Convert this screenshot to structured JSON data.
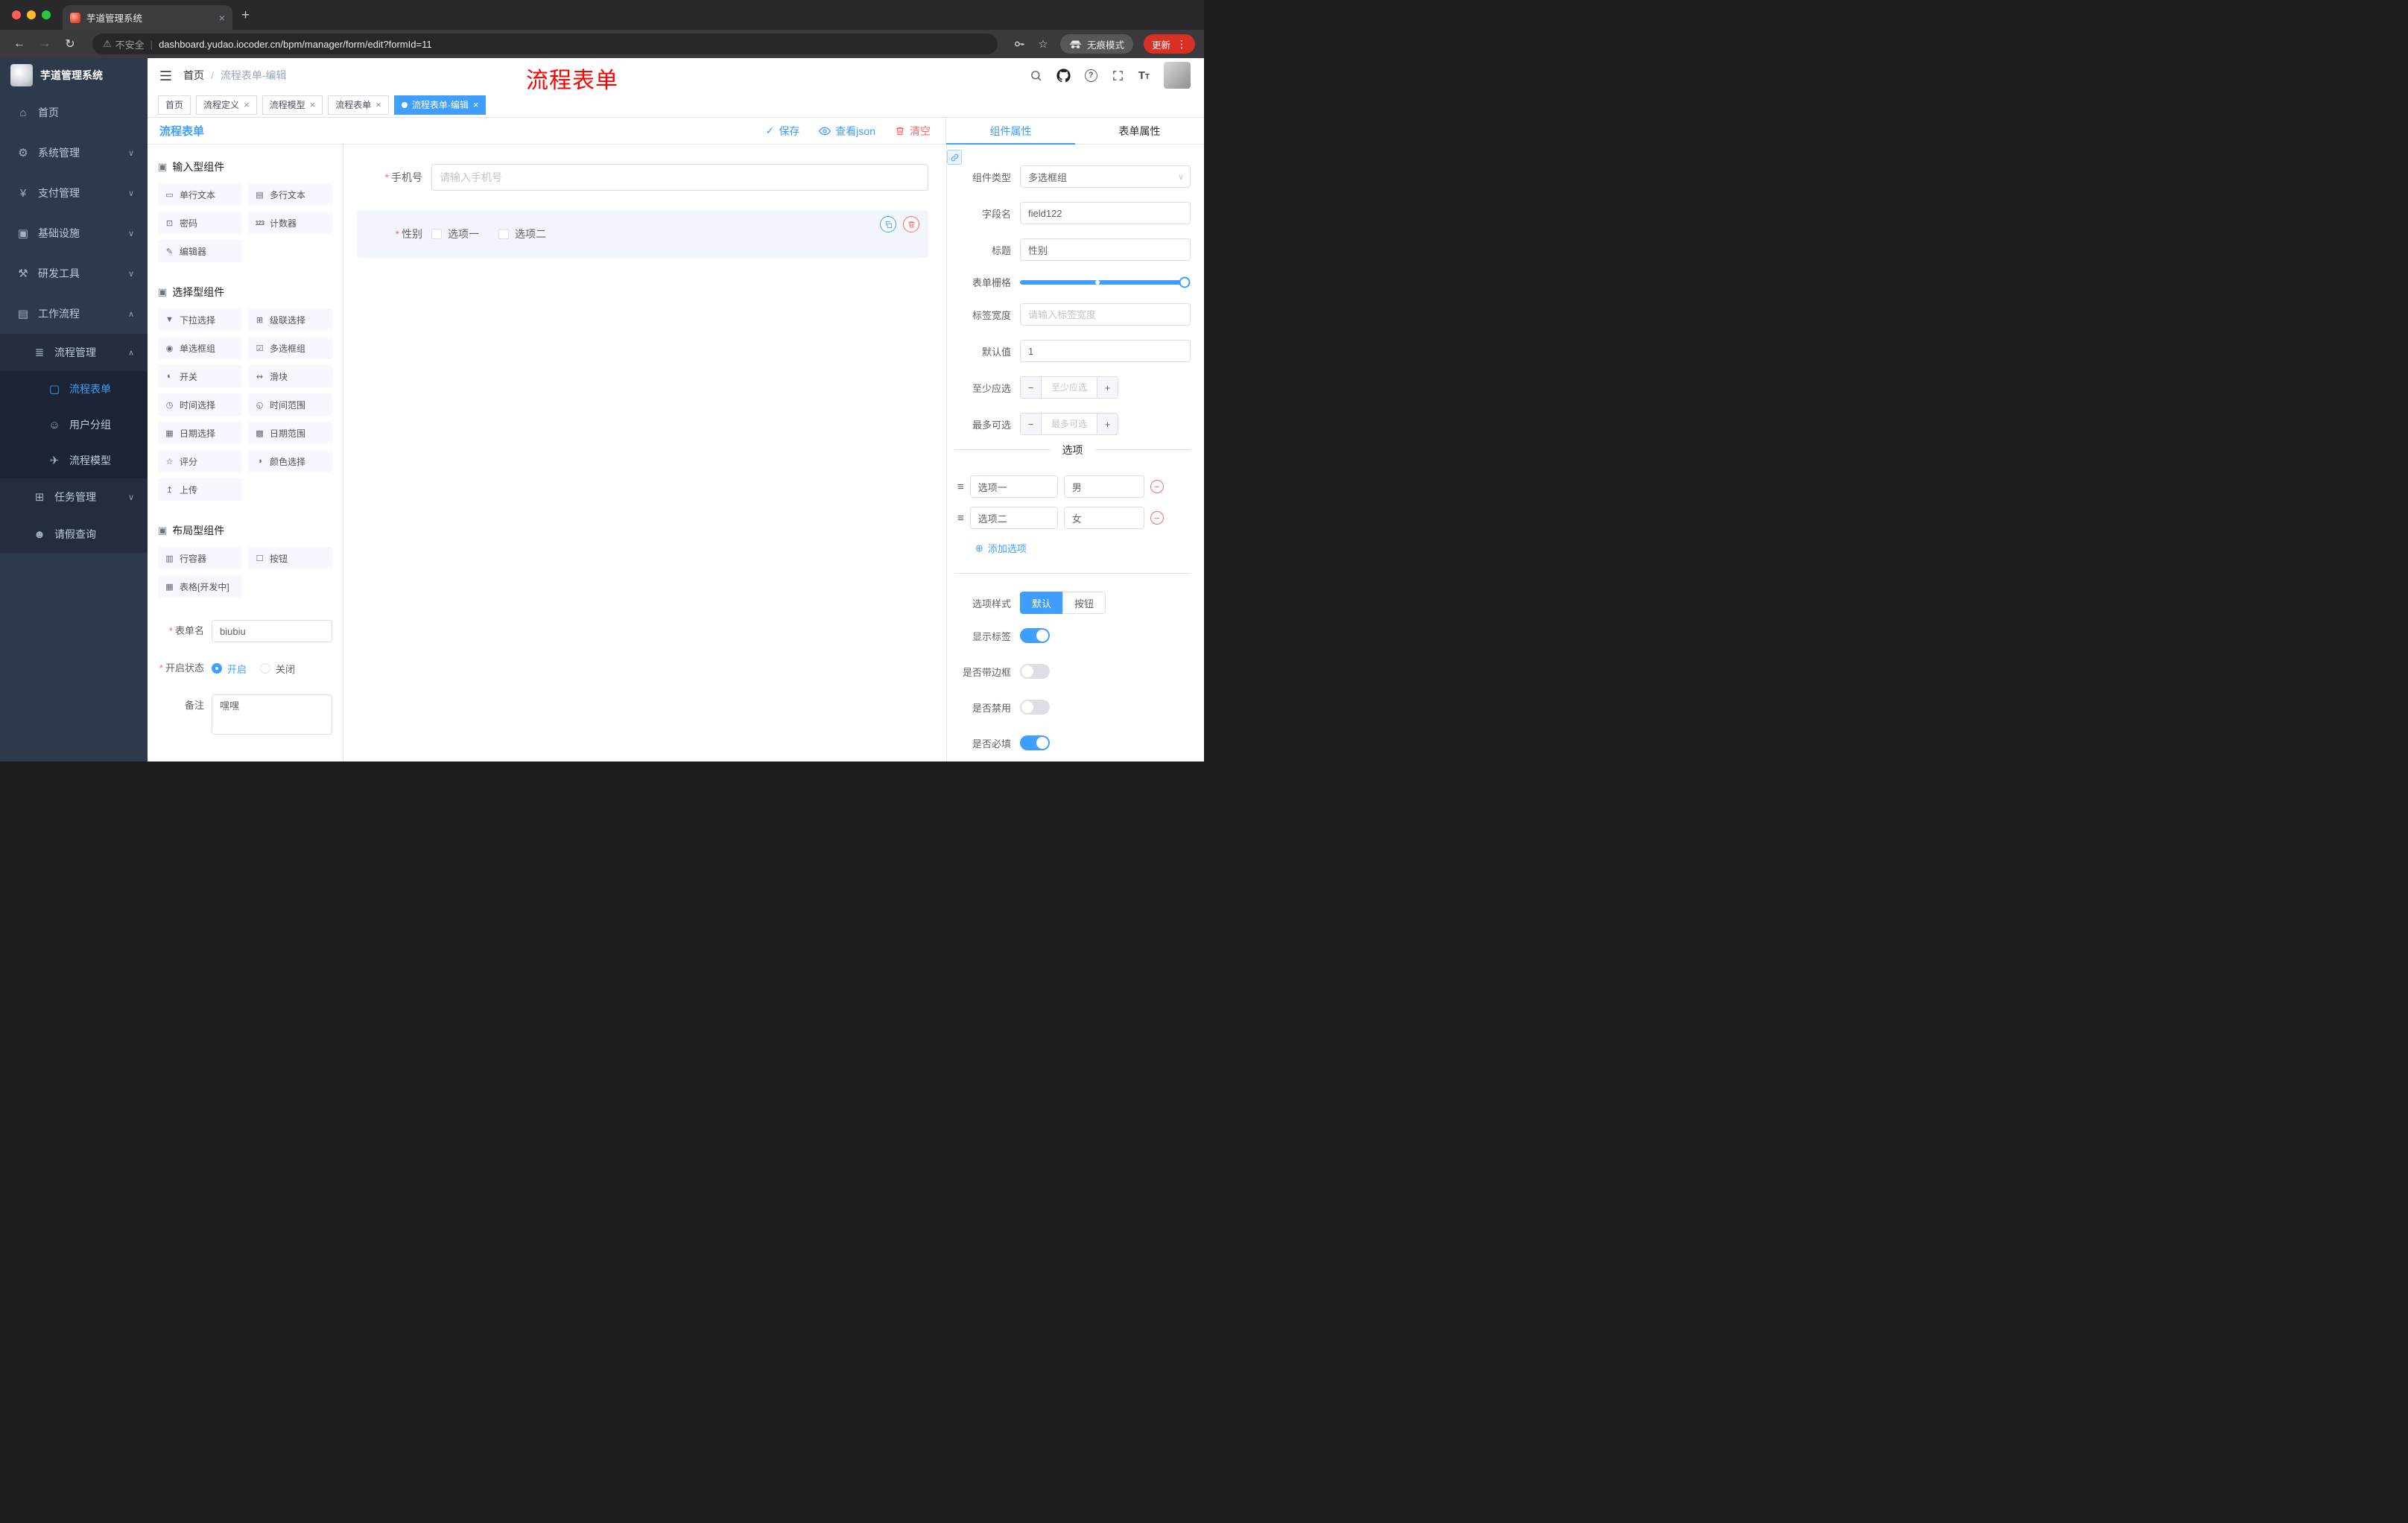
{
  "browser": {
    "tab_title": "芋道管理系统",
    "security_label": "不安全",
    "url": "dashboard.yudao.iocoder.cn/bpm/manager/form/edit?formId=11",
    "incognito_label": "无痕模式",
    "update_label": "更新"
  },
  "annotation": {
    "text": "流程表单"
  },
  "app_header": {
    "breadcrumb_home": "首页",
    "breadcrumb_current": "流程表单-编辑"
  },
  "tags": {
    "t0": "首页",
    "t1": "流程定义",
    "t2": "流程模型",
    "t3": "流程表单",
    "t4": "流程表单-编辑"
  },
  "sidebar": {
    "logo_title": "芋道管理系统",
    "items": [
      {
        "label": "首页"
      },
      {
        "label": "系统管理"
      },
      {
        "label": "支付管理"
      },
      {
        "label": "基础设施"
      },
      {
        "label": "研发工具"
      },
      {
        "label": "工作流程"
      },
      {
        "label": "流程管理"
      },
      {
        "label": "流程表单"
      },
      {
        "label": "用户分组"
      },
      {
        "label": "流程模型"
      },
      {
        "label": "任务管理"
      },
      {
        "label": "请假查询"
      }
    ]
  },
  "designer": {
    "title": "流程表单",
    "save": "保存",
    "view_json": "查看json",
    "clear": "清空",
    "palette": {
      "sec0": {
        "title": "输入型组件",
        "items": [
          "单行文本",
          "多行文本",
          "密码",
          "计数器",
          "编辑器"
        ]
      },
      "sec1": {
        "title": "选择型组件",
        "items": [
          "下拉选择",
          "级联选择",
          "单选框组",
          "多选框组",
          "开关",
          "滑块",
          "时间选择",
          "时间范围",
          "日期选择",
          "日期范围",
          "评分",
          "颜色选择",
          "上传"
        ]
      },
      "sec2": {
        "title": "布局型组件",
        "items": [
          "行容器",
          "按钮",
          "表格[开发中]"
        ]
      }
    },
    "meta": {
      "name_label": "表单名",
      "name_value": "biubiu",
      "status_label": "开启状态",
      "status_on": "开启",
      "status_off": "关闭",
      "remark_label": "备注",
      "remark_value": "嘿嘿"
    },
    "canvas": {
      "phone_label": "手机号",
      "phone_placeholder": "请输入手机号",
      "gender_label": "性别",
      "gender_opt1": "选项一",
      "gender_opt2": "选项二"
    }
  },
  "props": {
    "tab_component": "组件属性",
    "tab_form": "表单属性",
    "component_type_label": "组件类型",
    "component_type_value": "多选框组",
    "field_name_label": "字段名",
    "field_name_value": "field122",
    "title_label": "标题",
    "title_value": "性别",
    "grid_label": "表单栅格",
    "label_width_label": "标签宽度",
    "label_width_placeholder": "请输入标签宽度",
    "default_label": "默认值",
    "default_value": "1",
    "min_label": "至少应选",
    "min_placeholder": "至少应选",
    "max_label": "最多可选",
    "max_placeholder": "最多可选",
    "options_title": "选项",
    "opt1_label": "选项一",
    "opt1_value": "男",
    "opt2_label": "选项二",
    "opt2_value": "女",
    "add_option": "添加选项",
    "style_label": "选项样式",
    "style_default": "默认",
    "style_button": "按钮",
    "sw_show_label": "显示标签",
    "sw_border": "是否带边框",
    "sw_disabled": "是否禁用",
    "sw_required": "是否必填"
  },
  "icons": {
    "close": "×",
    "plus": "+",
    "menu_dots": "⋮",
    "warning": "⚠",
    "separator": "|",
    "star": "☆",
    "back": "←",
    "forward": "→",
    "reload": "↻",
    "chevron_down": "∨",
    "chevron_up": "∧",
    "home": "⌂",
    "gear": "⚙",
    "yuan": "¥",
    "infra": "▣",
    "tools": "⚒",
    "workflow": "▤",
    "list": "≣",
    "doc": "▢",
    "users": "☺",
    "send": "✈",
    "tasks": "⊞",
    "person": "☻",
    "section": "▣",
    "text_field": "▭",
    "textarea": "▤",
    "lock": "⊡",
    "counter": "123",
    "editor": "✎",
    "select": "▼",
    "cascade": "⊞",
    "radio": "◉",
    "checkbox": "☑",
    "switch": "◐",
    "slider": "↭",
    "time": "◷",
    "time_range": "◵",
    "date": "▦",
    "date_range": "▩",
    "rate": "☆",
    "color": "◑",
    "upload": "↥",
    "row": "▥",
    "button": "☐",
    "table": "▦",
    "check": "✓",
    "drag": "≡",
    "minus": "−",
    "circle_plus": "⊕",
    "question": "?"
  },
  "colors": {
    "accent": "#409eff",
    "danger": "#f56c6c",
    "annotation_red": "#ff0000",
    "update_pill": "#d93025",
    "sidebar_bg": "#2d3a4b",
    "tag_active": "#409eff"
  }
}
